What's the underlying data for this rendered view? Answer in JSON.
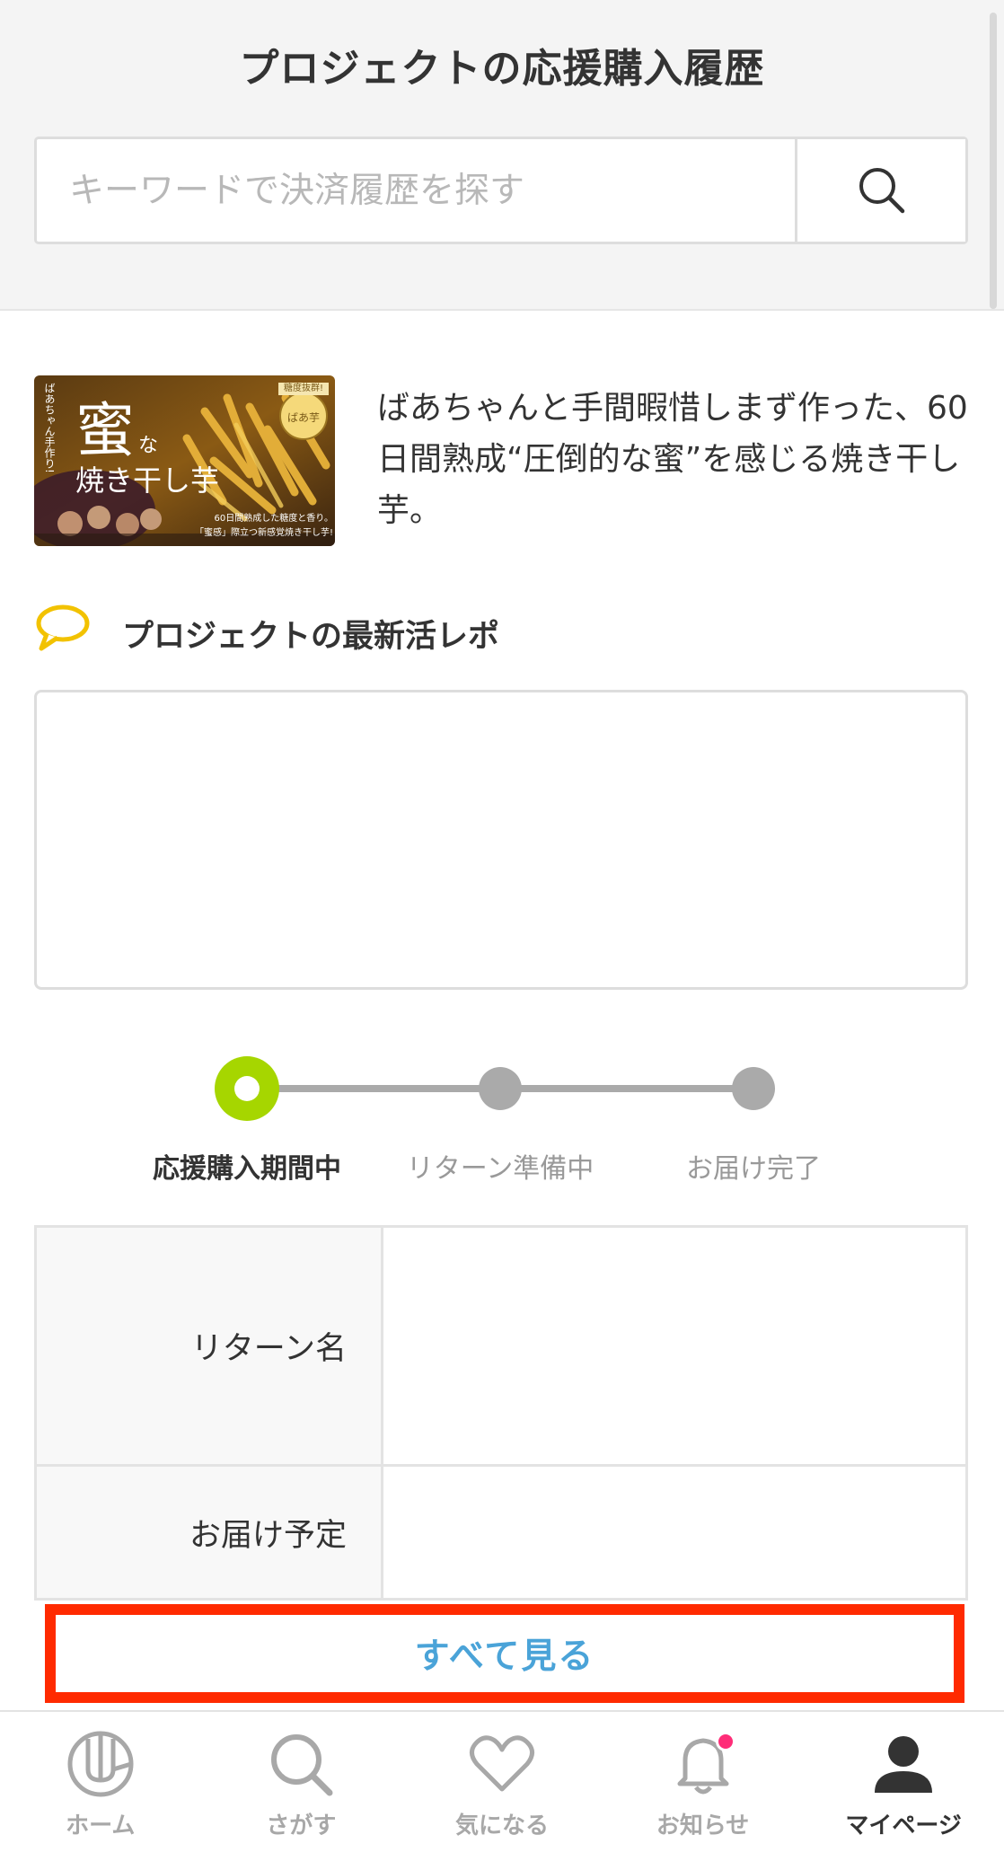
{
  "header": {
    "title": "プロジェクトの応援購入履歴",
    "search_placeholder": "キーワードで決済履歴を探す",
    "search_icon": "search-icon"
  },
  "project": {
    "thumbnail": {
      "side_text": "ばあちゃん手作り!",
      "main_text": "蜜",
      "small_text": "な",
      "sub_text": "焼き干し芋",
      "badge_text": "糖度抜群!",
      "seal_text": "ばあ芋",
      "caption_line1": "60日間熟成した糖度と香り。",
      "caption_line2": "「蜜感」際立つ新感覚焼き干し芋!"
    },
    "description": "ばあちゃんと手間暇惜しまず作った、60日間熟成“圧倒的な蜜”を感じる焼き干し芋。"
  },
  "report": {
    "title": "プロジェクトの最新活レポ",
    "icon": "speech-bubble-icon",
    "accent_color": "#f2c200"
  },
  "progress": {
    "steps": [
      {
        "label": "応援購入期間中",
        "state": "active"
      },
      {
        "label": "リターン準備中",
        "state": "pending"
      },
      {
        "label": "お届け完了",
        "state": "pending"
      }
    ],
    "active_color": "#a6d600",
    "pending_color": "#aaaaaa"
  },
  "info_table": {
    "rows": [
      {
        "label": "リターン名",
        "value": ""
      },
      {
        "label": "お届け予定",
        "value": ""
      }
    ]
  },
  "view_all": {
    "label": "すべて見る",
    "highlight_color": "#ff2a00",
    "text_color": "#4aa3d8"
  },
  "tabbar": {
    "items": [
      {
        "label": "ホーム",
        "icon": "home-logo-icon",
        "active": false
      },
      {
        "label": "さがす",
        "icon": "search-icon",
        "active": false
      },
      {
        "label": "気になる",
        "icon": "heart-icon",
        "active": false
      },
      {
        "label": "お知らせ",
        "icon": "bell-icon",
        "active": false,
        "badge": true
      },
      {
        "label": "マイページ",
        "icon": "user-icon",
        "active": true
      }
    ],
    "badge_color": "#ff2d78"
  }
}
